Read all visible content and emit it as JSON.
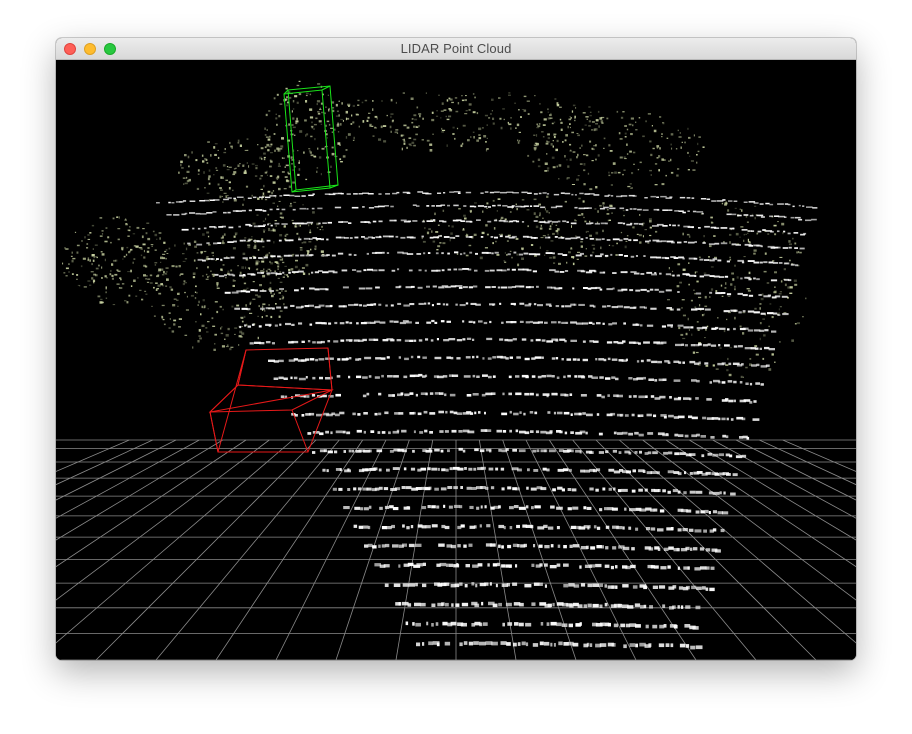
{
  "window": {
    "title": "LIDAR Point Cloud",
    "controls": {
      "close_icon": "close-icon",
      "minimize_icon": "minimize-icon",
      "zoom_icon": "zoom-icon"
    }
  },
  "viewport": {
    "background_color": "#000000",
    "grid_color": "#8a8a8a",
    "point_color": "#ffffff",
    "foliage_color": "#c9d3a2",
    "bounding_boxes": [
      {
        "label": "",
        "color": "#19e619"
      },
      {
        "label": "",
        "color": "#e61919"
      }
    ]
  }
}
